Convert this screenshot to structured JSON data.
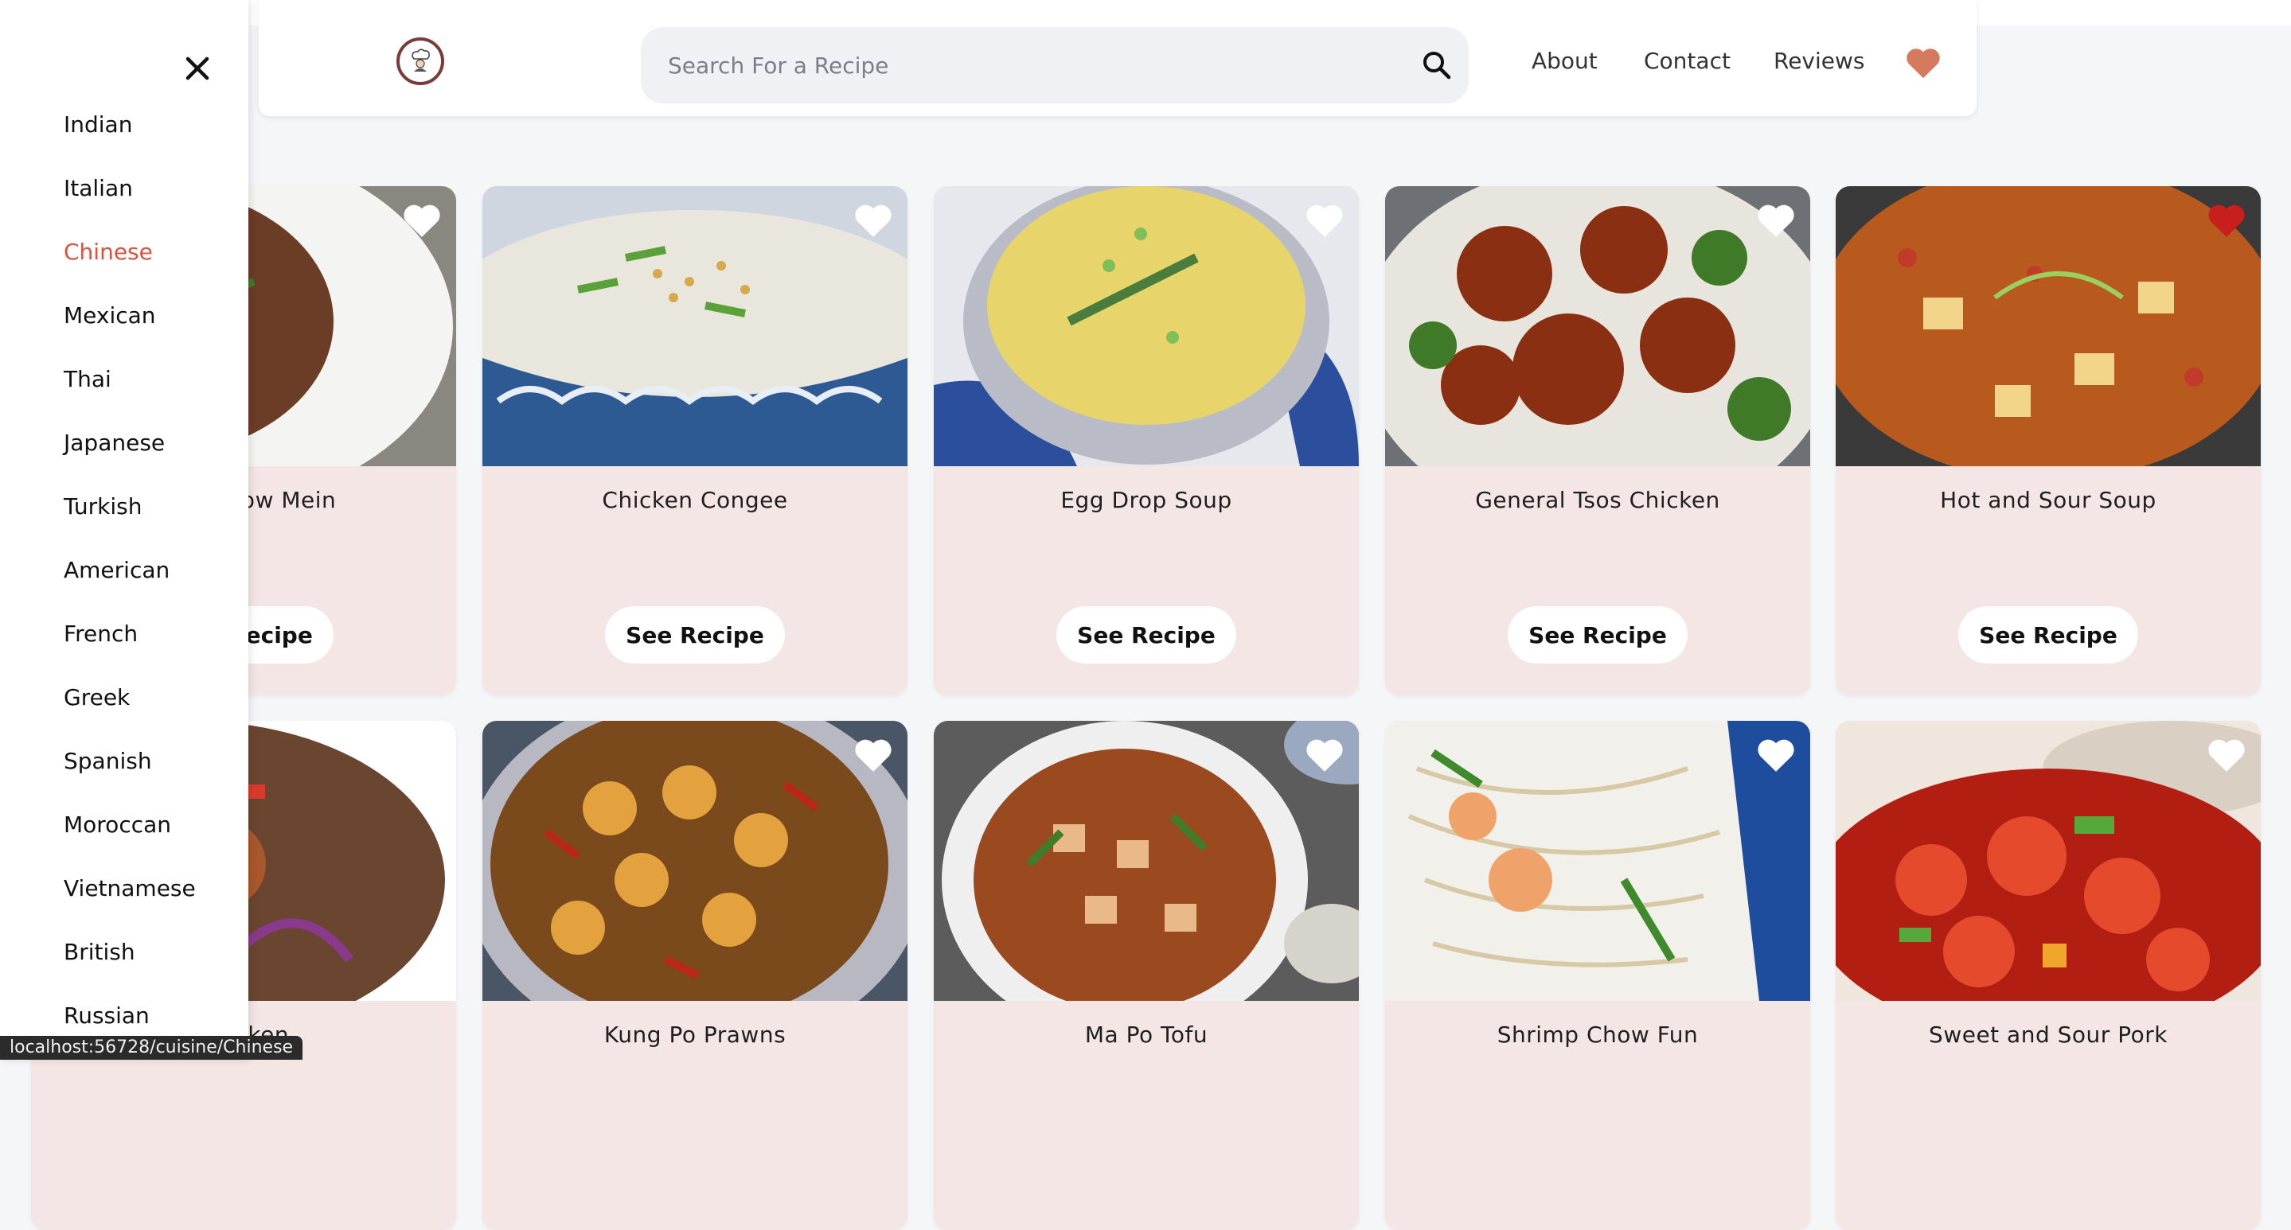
{
  "search": {
    "placeholder": "Search For a Recipe"
  },
  "nav": {
    "about": "About",
    "contact": "Contact",
    "reviews": "Reviews"
  },
  "sidebar": {
    "active": "Chinese",
    "cuisines": [
      "Indian",
      "Italian",
      "Chinese",
      "Mexican",
      "Thai",
      "Japanese",
      "Turkish",
      "American",
      "French",
      "Greek",
      "Spanish",
      "Moroccan",
      "Vietnamese",
      "British",
      "Russian"
    ]
  },
  "cards": [
    {
      "title": "Beef Chow Mein",
      "visible_title": "o Mein",
      "button": "See Recipe",
      "visible_button": "ecipe",
      "favorited": false
    },
    {
      "title": "Chicken Congee",
      "button": "See Recipe",
      "favorited": false
    },
    {
      "title": "Egg Drop Soup",
      "button": "See Recipe",
      "favorited": false
    },
    {
      "title": "General Tsos Chicken",
      "button": "See Recipe",
      "favorited": false
    },
    {
      "title": "Hot and Sour Soup",
      "button": "See Recipe",
      "favorited": true
    },
    {
      "title": "Chicken",
      "visible_title": "Chicken",
      "favorited": false
    },
    {
      "title": "Kung Po Prawns",
      "favorited": false
    },
    {
      "title": "Ma Po Tofu",
      "favorited": false
    },
    {
      "title": "Shrimp Chow Fun",
      "favorited": false
    },
    {
      "title": "Sweet and Sour Pork",
      "favorited": false
    }
  ],
  "status_url": "localhost:56728/cuisine/Chinese",
  "colors": {
    "accent": "#d9533e",
    "card_bg": "#f3e6e5",
    "heart_active": "#c81e1e",
    "nav_heart": "#d57a5f"
  }
}
